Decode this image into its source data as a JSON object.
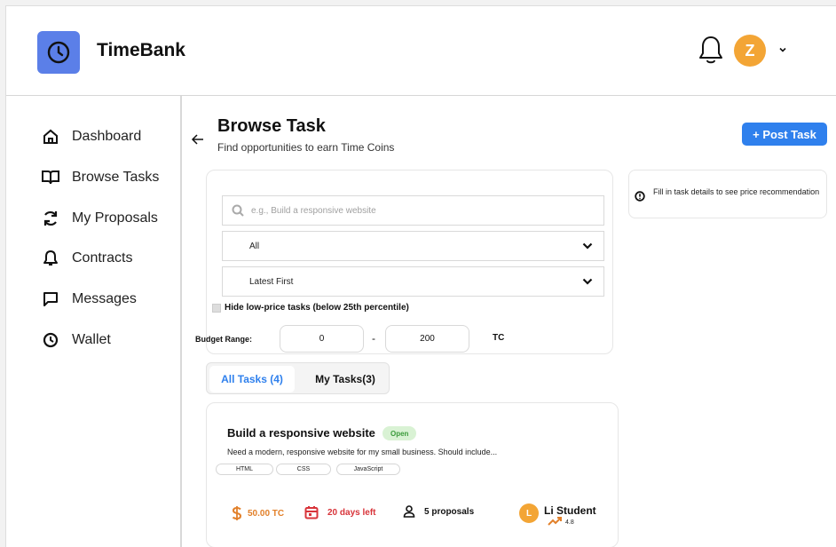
{
  "header": {
    "app_name": "TimeBank",
    "avatar_initial": "Z"
  },
  "sidebar": {
    "items": [
      {
        "label": "Dashboard",
        "icon": "home-icon"
      },
      {
        "label": "Browse Tasks",
        "icon": "book-icon"
      },
      {
        "label": "My Proposals",
        "icon": "refresh-icon"
      },
      {
        "label": "Contracts",
        "icon": "bell-icon"
      },
      {
        "label": "Messages",
        "icon": "message-icon"
      },
      {
        "label": "Wallet",
        "icon": "clock-icon"
      }
    ]
  },
  "main": {
    "title": "Browse Task",
    "subtitle": "Find opportunities to earn Time Coins",
    "post_button": "+ Post Task"
  },
  "filters": {
    "search_placeholder": "e.g., Build a responsive website",
    "category_value": "All",
    "sort_value": "Latest First",
    "hide_low_price_label": "Hide low-price tasks (below 25th percentile)",
    "budget_label": "Budget Range:",
    "budget_min": "0",
    "budget_dash": "-",
    "budget_max": "200",
    "budget_unit": "TC"
  },
  "info_box": {
    "text": "Fill in task details to see price recommendation"
  },
  "tabs": [
    {
      "label": "All Tasks (4)",
      "active": true
    },
    {
      "label": "My Tasks(3)",
      "active": false
    }
  ],
  "task": {
    "title": "Build a responsive website",
    "status": "Open",
    "description": "Need a modern, responsive website for my small business. Should include...",
    "tags": [
      "HTML",
      "CSS",
      "JavaScript"
    ],
    "price": "50.00 TC",
    "deadline": "20 days left",
    "proposals": "5 proposals",
    "author_initial": "L",
    "author_name": "Li Student",
    "rating": "4.8"
  },
  "colors": {
    "accent": "#2f80ed",
    "logo": "#5b7fe8",
    "avatar": "#f3a535",
    "price": "#e2802a",
    "deadline": "#d8343a",
    "badge_bg": "#d9f2d4",
    "badge_text": "#3a9a3a"
  }
}
